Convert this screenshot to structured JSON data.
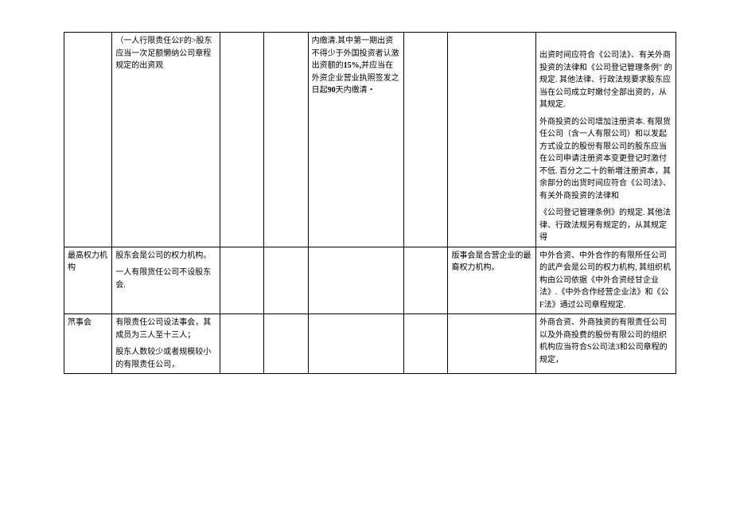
{
  "rows": [
    {
      "c1": "",
      "c2": "（一人行限责任公F的>股东应当一次足额懒纳公司章程规定的出资观",
      "c3": "",
      "c4": "",
      "c5_p1": "内缴清.其中第一期出资不得少于外国投资者认激出资额的",
      "c5_b1": "15%,",
      "c5_p1b": "并应当在外资企业营业执照签发之日起",
      "c5_b2": "90",
      "c5_p1c": "天内缴清・",
      "c6": "",
      "c7": "",
      "c8_p1": "出资时间应符合《公司法》、有关外商投资的法律和《公司登记管理条例\" 的规定. 其他法律、行政法规要求股东应当在公司成立时嫩付全部出资的，从其规定.",
      "c8_p2": "外商投资的公司增加注册资本. 有限货任公司（含一人有限公司）和以发起方式设立的股份有限公司的股东应当在公司申请注册资本变更登记时激付不低. 百分之二十的新増注册资本，其余部分的出货时间应符合《公司法》、有关外商投资的法律和",
      "c8_p3": "《公司登记管理条例》的规定. 其他法律、行政法规另有规定的，从其规定得"
    },
    {
      "c1": "最高权力机构",
      "c2_p1": "股东会是公司的权力机构。",
      "c2_p2": "一人有限货任公司不设股东会.",
      "c3": "",
      "c4": "",
      "c5": "",
      "c6": "",
      "c7": "版事会是合营企业的最裔权力机构。",
      "c8": "中外合资、中外合作的有限所任公司的武产会是公司的权力机构, 其组织机构由公司依据《中外合资经甘企业法》.《中外合作经营企业法》和《公F法》通过公司章程规定."
    },
    {
      "c1": "笊事会",
      "c2_p1": "有限责任公司设法事会，其成员为三人至十三人；",
      "c2_p2": "股东人数较少或者规模较小的有限责任公司，",
      "c3": "",
      "c4": "",
      "c5": "",
      "c6": "",
      "c7": "",
      "c8": "外商合资、外商独资的有限责任公司以及外商投费的股份有限公司的组织机构应当符合S公司法3和公司章程的规定，"
    }
  ]
}
